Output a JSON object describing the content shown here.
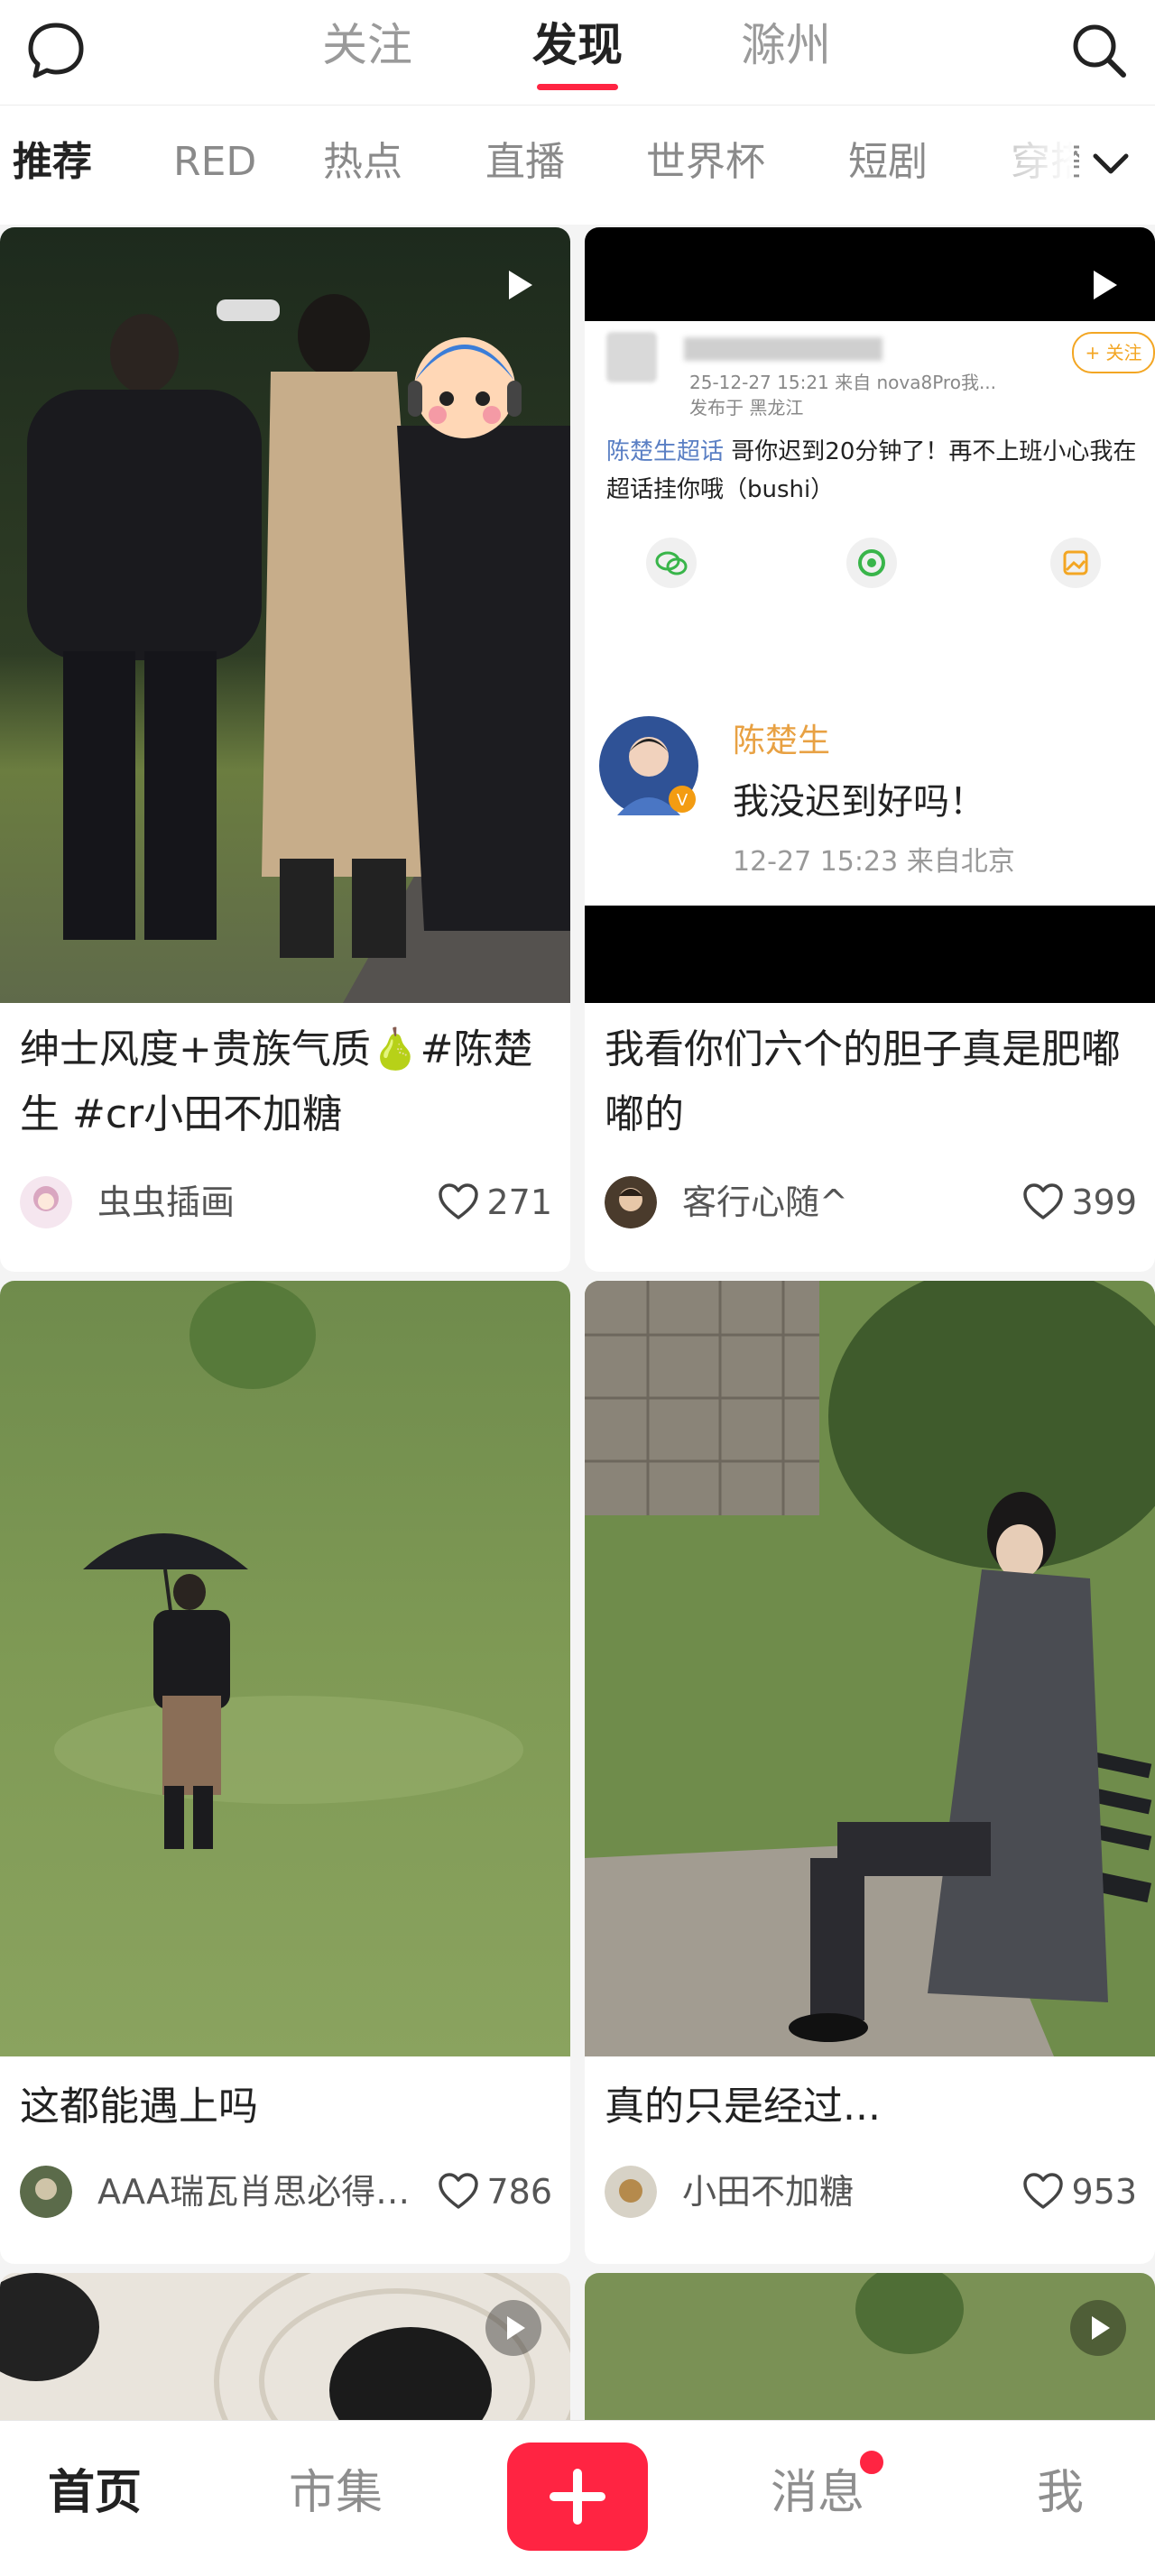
{
  "top_nav": {
    "tabs": [
      "关注",
      "发现",
      "滁州"
    ],
    "active_tab": "发现",
    "left_icon": "chat-bubble-icon",
    "right_icon": "search-icon"
  },
  "channels": {
    "items": [
      "推荐",
      "RED",
      "热点",
      "直播",
      "世界杯",
      "短剧",
      "穿搭"
    ],
    "active": "推荐",
    "more_icon": "chevron-down-icon"
  },
  "feed": [
    {
      "title": "绅士风度+贵族气质🍐#陈楚生 #cr小田不加糖",
      "author": "虫虫插画",
      "likes": "271",
      "is_video": true
    },
    {
      "title": "我看你们六个的胆子真是肥嘟嘟的",
      "author": "客行心随^",
      "likes": "399",
      "is_video": true,
      "screenshot": {
        "follow_label": "+ 关注",
        "post_meta": "25-12-27 15:21 来自 nova8Pro我...",
        "post_location": "发布于 黑龙江",
        "post_text_tag": "陈楚生超话",
        "post_text": " 哥你迟到20分钟了！再不上班小心我在超话挂你哦（bushi）",
        "reply_name": "陈楚生",
        "reply_text": "我没迟到好吗！",
        "reply_meta": "12-27 15:23 来自北京"
      }
    },
    {
      "title": "这都能遇上吗",
      "author": "AAA瑞瓦肖思必得…",
      "likes": "786",
      "is_video": false
    },
    {
      "title": "真的只是经过...",
      "author": "小田不加糖",
      "likes": "953",
      "is_video": false
    },
    {
      "is_video": true
    },
    {
      "is_video": true
    }
  ],
  "bottom_bar": {
    "tabs": [
      "首页",
      "市集",
      "消息",
      "我"
    ],
    "active": "首页",
    "add_icon": "plus-icon",
    "has_message_badge": true
  },
  "colors": {
    "accent": "#ff2442",
    "background": "#f4f4f4"
  }
}
